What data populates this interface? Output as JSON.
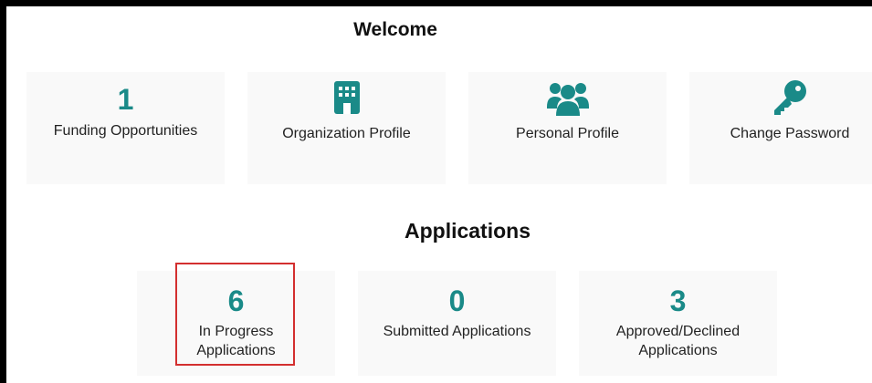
{
  "colors": {
    "accent": "#1a8a88",
    "highlight": "#d32f2f",
    "card_bg": "#f9f9f9"
  },
  "welcome": {
    "title": "Welcome",
    "cards": [
      {
        "number": "1",
        "label": "Funding Opportunities"
      },
      {
        "icon": "building-icon",
        "label": "Organization Profile"
      },
      {
        "icon": "users-icon",
        "label": "Personal Profile"
      },
      {
        "icon": "key-icon",
        "label": "Change Password"
      }
    ]
  },
  "applications": {
    "title": "Applications",
    "cards": [
      {
        "number": "6",
        "label_line1": "In Progress",
        "label_line2": "Applications",
        "highlighted": true
      },
      {
        "number": "0",
        "label_line1": "Submitted Applications",
        "label_line2": ""
      },
      {
        "number": "3",
        "label_line1": "Approved/Declined",
        "label_line2": "Applications"
      }
    ]
  }
}
